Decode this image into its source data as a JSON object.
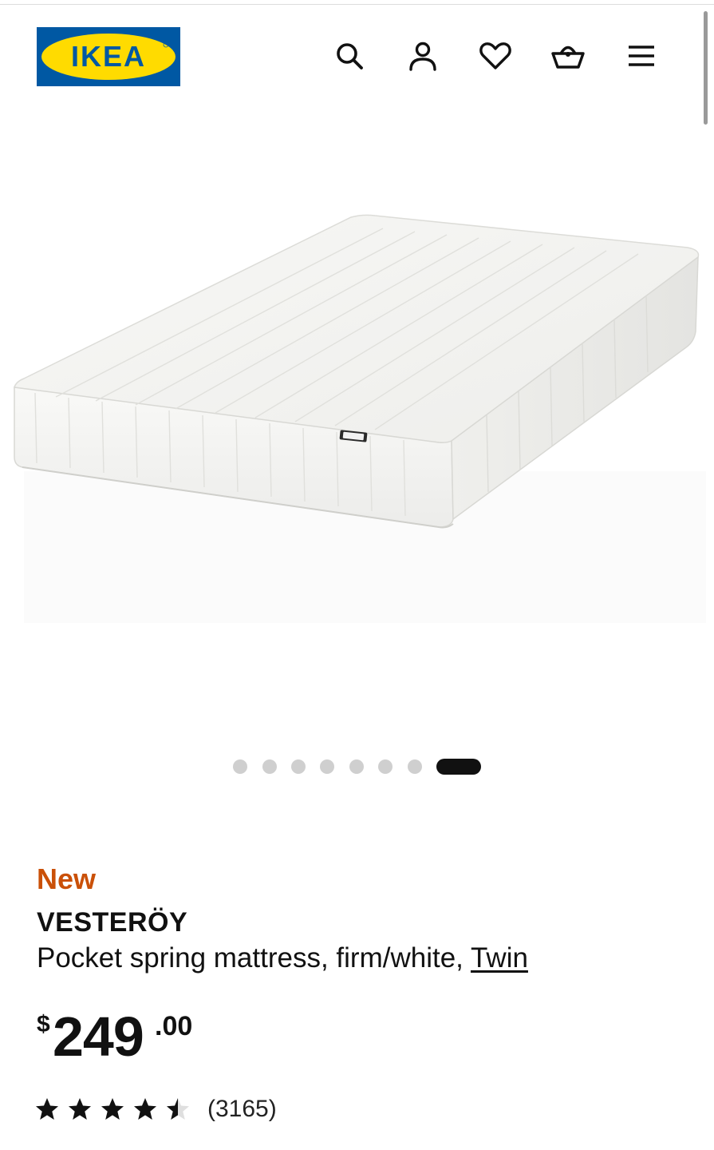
{
  "header": {
    "logo_text": "IKEA",
    "icons": [
      "search-icon",
      "account-icon",
      "heart-icon",
      "basket-icon",
      "menu-icon"
    ],
    "brand_colors": {
      "blue": "#0058A3",
      "yellow": "#FFDB00"
    }
  },
  "gallery": {
    "image_count": 8,
    "active_index": 7
  },
  "product": {
    "badge": "New",
    "badge_color": "#CA5008",
    "name": "VESTERÖY",
    "description": "Pocket spring mattress, firm/white, ",
    "size_link": "Twin",
    "price": {
      "currency": "$",
      "integer": "249",
      "decimal": ".00"
    },
    "rating": {
      "value": 4.5,
      "max": 5,
      "count_text": "(3165)"
    }
  }
}
